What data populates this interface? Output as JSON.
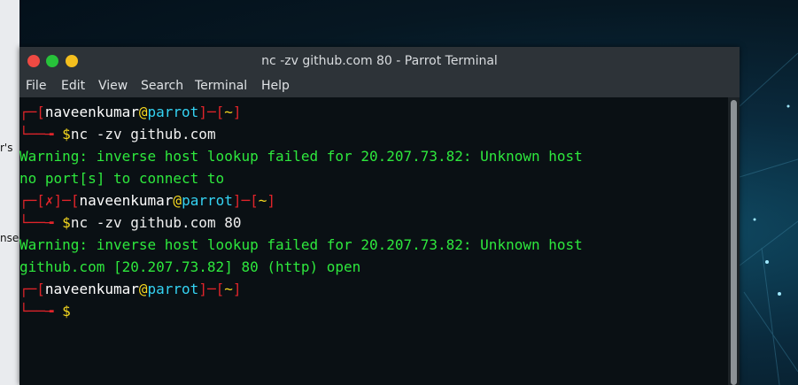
{
  "window": {
    "title": "nc -zv github.com 80 - Parrot Terminal"
  },
  "menu": [
    "File",
    "Edit",
    "View",
    "Search",
    "Terminal",
    "Help"
  ],
  "desktop_fragments": [
    "r's",
    "nse"
  ],
  "terminal": {
    "user": "naveenkumar",
    "at": "@",
    "host": "parrot",
    "dir": "~",
    "fail_mark": "✗",
    "prompt_symbol": "$",
    "cmd1": "nc -zv github.com",
    "out1": "Warning: inverse host lookup failed for 20.207.73.82: Unknown host",
    "out2": "no port[s] to connect to",
    "cmd2": "nc -zv github.com 80",
    "out3": "Warning: inverse host lookup failed for 20.207.73.82: Unknown host",
    "out4": "github.com [20.207.73.82] 80 (http) open"
  },
  "colors": {
    "prompt_bracket": "#e0242a",
    "user": "#ffffff",
    "host": "#34d3f3",
    "dollar": "#f6d81f",
    "output": "#2ee83d"
  }
}
